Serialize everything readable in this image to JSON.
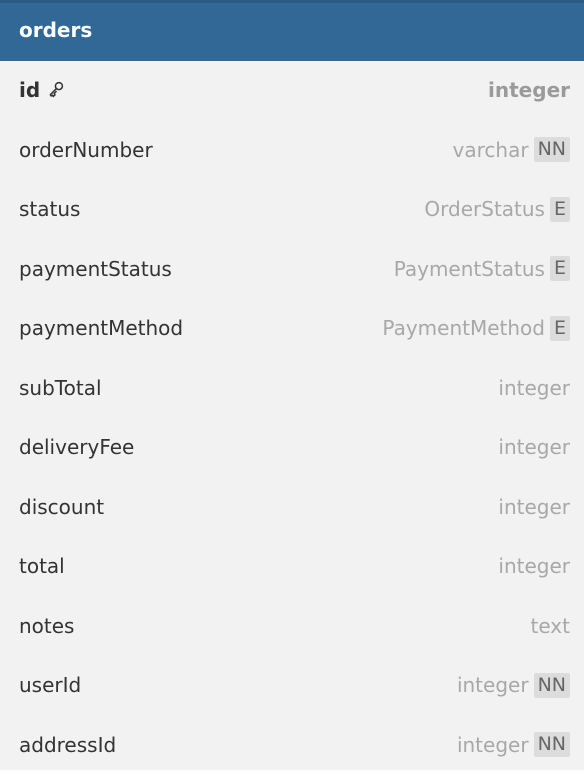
{
  "table": {
    "name": "orders",
    "fields": [
      {
        "name": "id",
        "type": "integer",
        "badge": "",
        "primary_key": true,
        "icon": "key-icon"
      },
      {
        "name": "orderNumber",
        "type": "varchar",
        "badge": "NN"
      },
      {
        "name": "status",
        "type": "OrderStatus",
        "badge": "E"
      },
      {
        "name": "paymentStatus",
        "type": "PaymentStatus",
        "badge": "E"
      },
      {
        "name": "paymentMethod",
        "type": "PaymentMethod",
        "badge": "E"
      },
      {
        "name": "subTotal",
        "type": "integer",
        "badge": ""
      },
      {
        "name": "deliveryFee",
        "type": "integer",
        "badge": ""
      },
      {
        "name": "discount",
        "type": "integer",
        "badge": ""
      },
      {
        "name": "total",
        "type": "integer",
        "badge": ""
      },
      {
        "name": "notes",
        "type": "text",
        "badge": ""
      },
      {
        "name": "userId",
        "type": "integer",
        "badge": "NN"
      },
      {
        "name": "addressId",
        "type": "integer",
        "badge": "NN"
      }
    ]
  },
  "colors": {
    "header": "#316896",
    "body": "#f2f2f2",
    "field_name": "#333333",
    "field_type": "#a8a8a8",
    "badge_bg": "#dcdcdc"
  }
}
